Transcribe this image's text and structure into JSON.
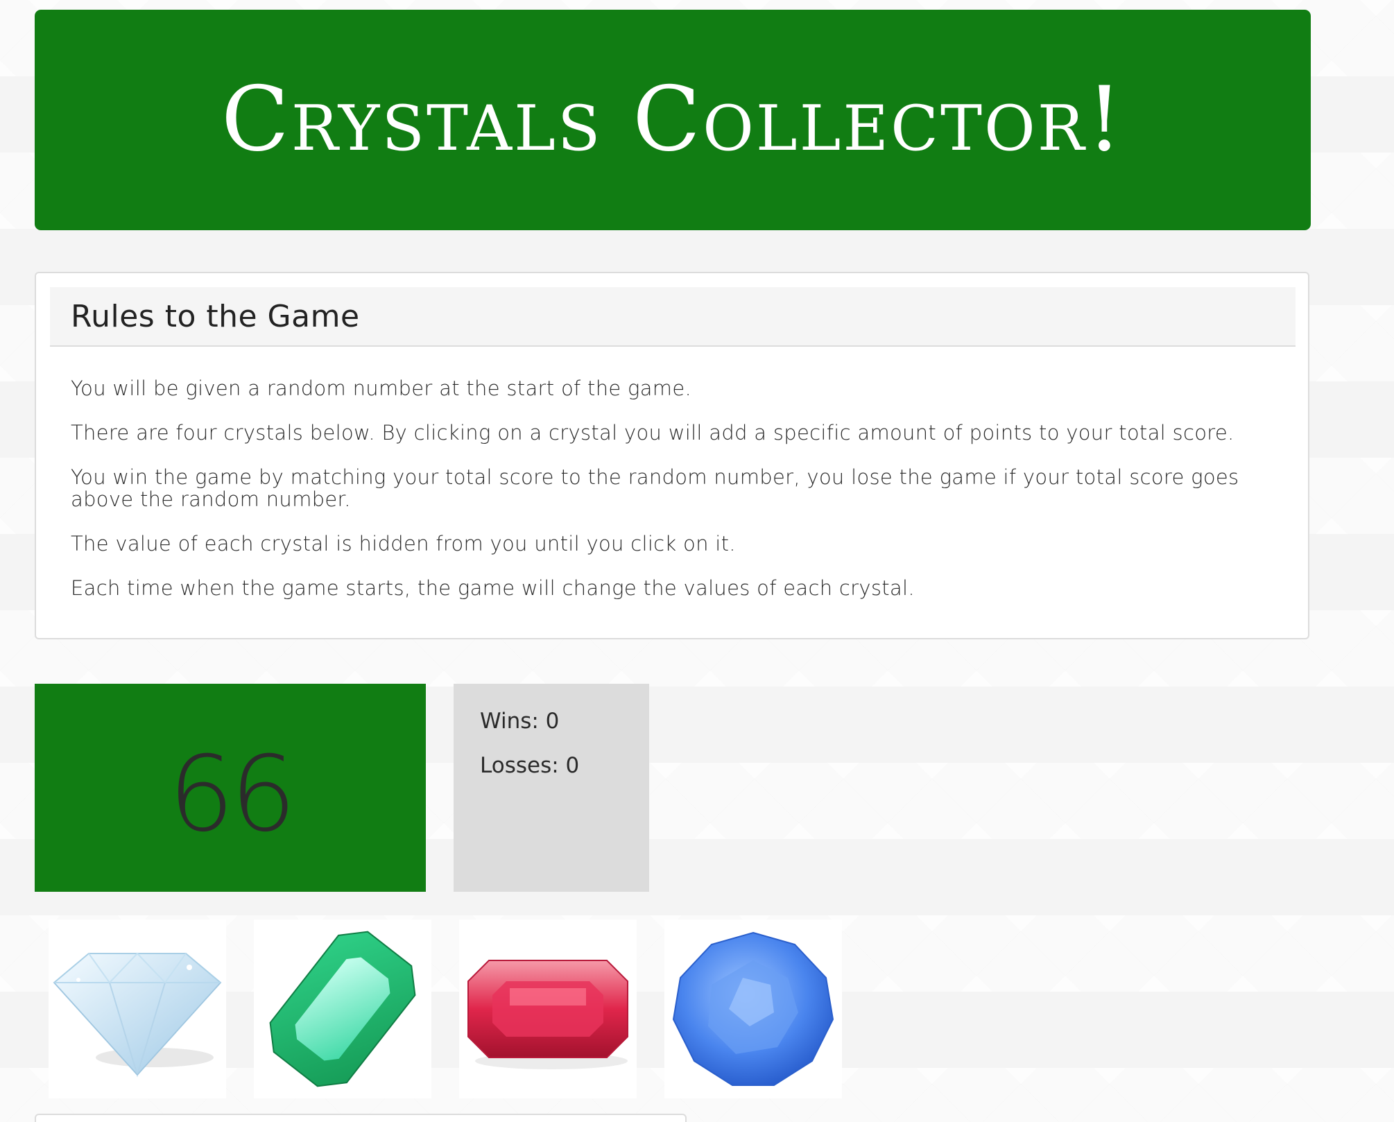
{
  "header": {
    "title": "Crystals Collector!"
  },
  "rules": {
    "heading": "Rules to the Game",
    "items": [
      "You will be given a random number at the start of the game.",
      "There are four crystals below. By clicking on a crystal you will add a specific amount of points to your total score.",
      "You win the game by matching your total score to the random number, you lose the game if your total score goes above the random number.",
      "The value of each crystal is hidden from you until you click on it.",
      "Each time when the game starts, the game will change the values of each crystal."
    ]
  },
  "game": {
    "target_number": "66",
    "wins_label": "Wins: 0",
    "losses_label": "Losses: 0"
  },
  "crystals": [
    {
      "name": "diamond",
      "color": "#d6ecf7"
    },
    {
      "name": "emerald",
      "color": "#22b86a"
    },
    {
      "name": "ruby",
      "color": "#d81e47"
    },
    {
      "name": "sapphire",
      "color": "#3a78e6"
    }
  ],
  "colors": {
    "accent_green": "#117d13",
    "stats_gray": "#dcdcdc"
  }
}
